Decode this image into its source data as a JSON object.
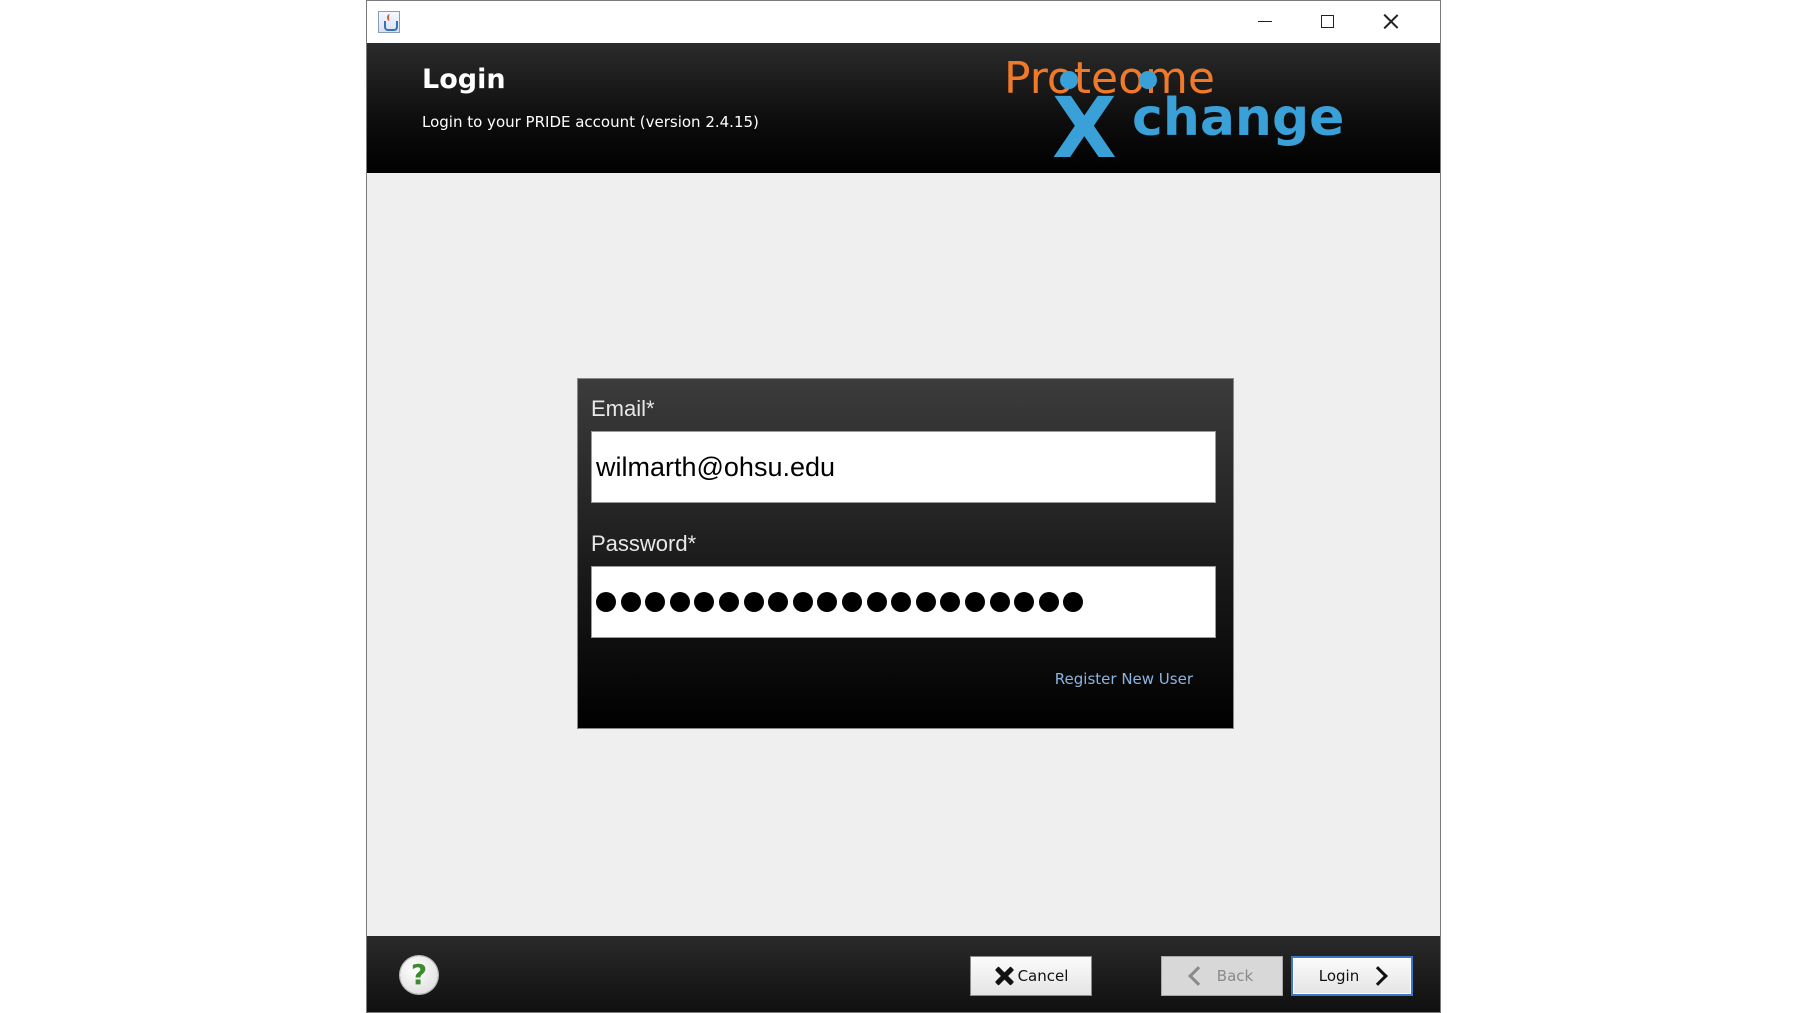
{
  "window": {
    "icon": "java-cup-icon",
    "controls": {
      "minimize": "minimize-icon",
      "maximize": "maximize-icon",
      "close": "close-icon"
    }
  },
  "header": {
    "title": "Login",
    "subtitle": "Login to your PRIDE account (version 2.4.15)",
    "logo": {
      "line1": "Proteome",
      "line2_x": "X",
      "line2_rest": "change",
      "colors": {
        "orange": "#f07a2a",
        "blue": "#3aa0d8"
      }
    }
  },
  "login_form": {
    "email_label": "Email*",
    "email_value": "wilmarth@ohsu.edu",
    "password_label": "Password*",
    "password_dot_count": 20,
    "register_link": "Register New User"
  },
  "footer": {
    "help_icon": "help-icon",
    "cancel_label": "Cancel",
    "back_label": "Back",
    "login_label": "Login"
  }
}
